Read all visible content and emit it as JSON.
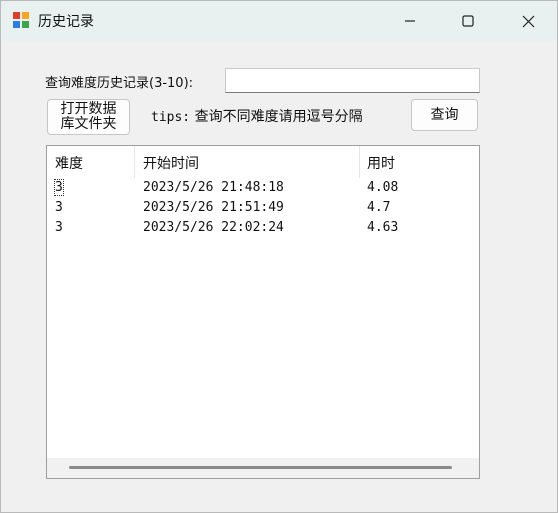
{
  "window": {
    "title": "历史记录"
  },
  "form": {
    "query_label": "查询难度历史记录(3-10):",
    "query_value": "",
    "open_db_label_line1": "打开数据",
    "open_db_label_line2": "库文件夹",
    "tips_prefix": "tips:",
    "tips_text": "查询不同难度请用逗号分隔",
    "query_button_label": "查询"
  },
  "table": {
    "columns": [
      "难度",
      "开始时间",
      "用时"
    ],
    "rows": [
      {
        "difficulty": "3",
        "start_time": "2023/5/26 21:48:18",
        "duration": "4.08"
      },
      {
        "difficulty": "3",
        "start_time": "2023/5/26 21:51:49",
        "duration": "4.7"
      },
      {
        "difficulty": "3",
        "start_time": "2023/5/26 22:02:24",
        "duration": "4.63"
      }
    ]
  },
  "icons": {
    "app": "app-icon",
    "minimize": "minimize-icon",
    "maximize": "maximize-icon",
    "close": "close-icon"
  },
  "colors": {
    "titlebar": "#e8f1ef",
    "window_bg": "#f0f0f0",
    "list_bg": "#ffffff"
  }
}
